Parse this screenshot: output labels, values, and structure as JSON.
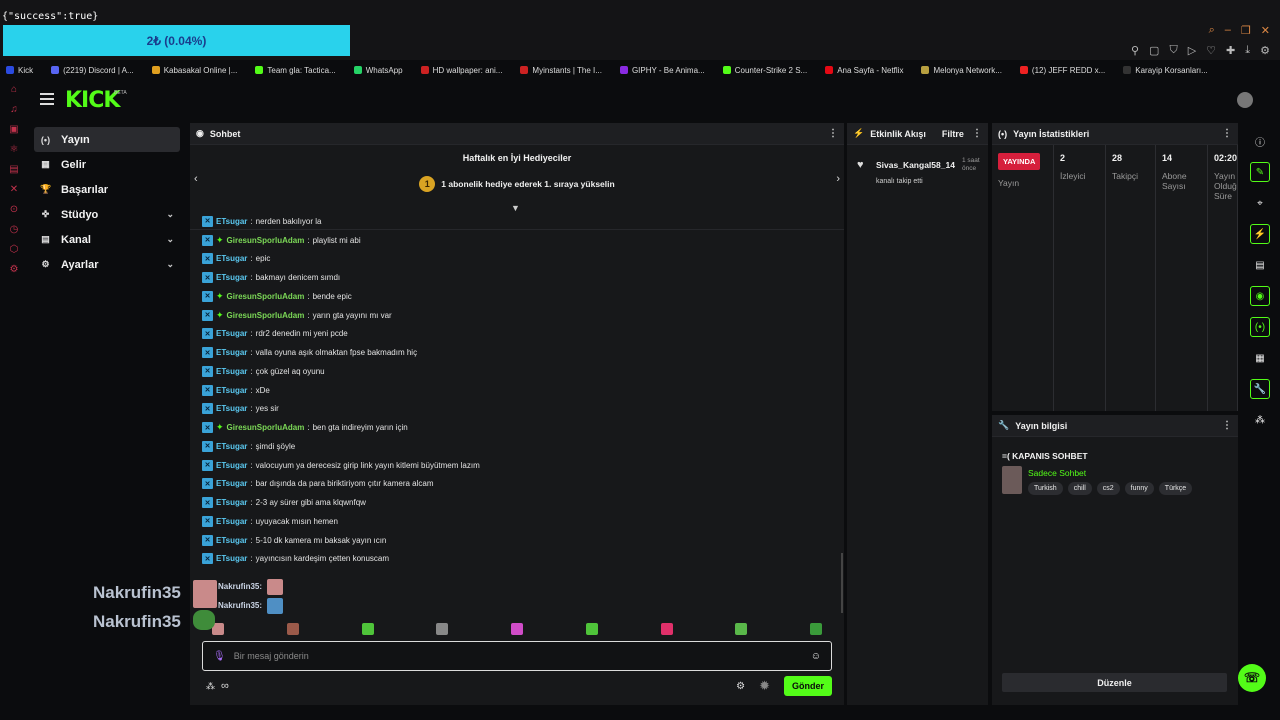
{
  "overlay": {
    "success_text": "{\"success\":true}",
    "donation_bar": "2₺ (0.04%)",
    "nick_primary": "Nakrufin35",
    "nick_secondary": "Nakrufin35"
  },
  "bookmarks": [
    {
      "label": "Kick",
      "color": "#2b4be0"
    },
    {
      "label": "(2219) Discord | A...",
      "color": "#5865f2"
    },
    {
      "label": "Kabasakal Online |...",
      "color": "#e0a020"
    },
    {
      "label": "Team gla: Tactica...",
      "color": "#53fc18"
    },
    {
      "label": "WhatsApp",
      "color": "#25d366"
    },
    {
      "label": "HD wallpaper: ani...",
      "color": "#c22"
    },
    {
      "label": "Myinstants | The I...",
      "color": "#c22"
    },
    {
      "label": "GIPHY - Be Anima...",
      "color": "#8a2be2"
    },
    {
      "label": "Counter-Strike 2 S...",
      "color": "#53fc18"
    },
    {
      "label": "Ana Sayfa - Netflix",
      "color": "#e50914"
    },
    {
      "label": "Melonya Network...",
      "color": "#b8a040"
    },
    {
      "label": "(12) JEFF REDD x...",
      "color": "#e22"
    },
    {
      "label": "Karayip Korsanları...",
      "color": "#333"
    }
  ],
  "nav": {
    "items": [
      {
        "label": "Yayın",
        "icon": "(•)",
        "chev": ""
      },
      {
        "label": "Gelir",
        "icon": "▦",
        "chev": ""
      },
      {
        "label": "Başarılar",
        "icon": "🏆",
        "chev": ""
      },
      {
        "label": "Stüdyo",
        "icon": "✜",
        "chev": "⌄"
      },
      {
        "label": "Kanal",
        "icon": "▤",
        "chev": "⌄"
      },
      {
        "label": "Ayarlar",
        "icon": "⚙",
        "chev": "⌄"
      }
    ]
  },
  "chat": {
    "title": "Sohbet",
    "gifters_title": "Haftalık en İyi Hediyeciler",
    "gifters_rank": "1",
    "gifters_cta": "1 abonelik hediye ederek 1. sıraya yükselin",
    "messages": [
      {
        "user": "ETsugar",
        "text": "nerden bakılıyor la",
        "color": "#5ac8f0",
        "vip": false
      },
      {
        "user": "GiresunSporluAdam",
        "text": "playlist mi abi",
        "color": "#7cd957",
        "vip": true
      },
      {
        "user": "ETsugar",
        "text": "epic",
        "color": "#5ac8f0",
        "vip": false
      },
      {
        "user": "ETsugar",
        "text": "bakmayı denicem sımdı",
        "color": "#5ac8f0",
        "vip": false
      },
      {
        "user": "GiresunSporluAdam",
        "text": "bende epic",
        "color": "#7cd957",
        "vip": true
      },
      {
        "user": "GiresunSporluAdam",
        "text": "yarın gta yayını mı var",
        "color": "#7cd957",
        "vip": true
      },
      {
        "user": "ETsugar",
        "text": "rdr2 denedin mi yeni pcde",
        "color": "#5ac8f0",
        "vip": false
      },
      {
        "user": "ETsugar",
        "text": "valla oyuna aşık olmaktan fpse bakmadım hiç",
        "color": "#5ac8f0",
        "vip": false
      },
      {
        "user": "ETsugar",
        "text": "çok güzel aq oyunu",
        "color": "#5ac8f0",
        "vip": false
      },
      {
        "user": "ETsugar",
        "text": "xDe",
        "color": "#5ac8f0",
        "vip": false
      },
      {
        "user": "ETsugar",
        "text": "yes sir",
        "color": "#5ac8f0",
        "vip": false
      },
      {
        "user": "GiresunSporluAdam",
        "text": "ben gta indireyim yarın için",
        "color": "#7cd957",
        "vip": true
      },
      {
        "user": "ETsugar",
        "text": "şimdi şöyle",
        "color": "#5ac8f0",
        "vip": false
      },
      {
        "user": "ETsugar",
        "text": "valocuyum ya derecesiz girip link yayın kitlemi büyütmem lazım",
        "color": "#5ac8f0",
        "vip": false
      },
      {
        "user": "ETsugar",
        "text": "bar dışında da para biriktiriyom çıtır kamera alcam",
        "color": "#5ac8f0",
        "vip": false
      },
      {
        "user": "ETsugar",
        "text": "2-3 ay sürer gibi ama klqwnfqw",
        "color": "#5ac8f0",
        "vip": false
      },
      {
        "user": "ETsugar",
        "text": "uyuyacak mısın hemen",
        "color": "#5ac8f0",
        "vip": false
      },
      {
        "user": "ETsugar",
        "text": "5-10 dk kamera mı baksak yayın ıcın",
        "color": "#5ac8f0",
        "vip": false
      },
      {
        "user": "ETsugar",
        "text": "yayıncısın kardeşim çetten konuscam",
        "color": "#5ac8f0",
        "vip": false
      }
    ],
    "extra_msgs": [
      {
        "user": "Nakrufin35:"
      },
      {
        "user": "Nakrufin35:"
      }
    ],
    "emote_colors": [
      "#c98a8a",
      "#9b5a4a",
      "#4fc43a",
      "#888",
      "#d04cc8",
      "#4fc43a",
      "#e0306a",
      "#5ab84a",
      "#3a9a3a"
    ],
    "input_placeholder": "Bir mesaj gönderin",
    "infinity": "∞",
    "send_label": "Gönder"
  },
  "activity": {
    "title": "Etkinlik Akışı",
    "filter_label": "Filtre",
    "item": {
      "user": "Sivas_Kangal58_14",
      "time": "1 saat önce",
      "desc": "kanalı takip etti"
    }
  },
  "stats": {
    "title": "Yayın İstatistikleri",
    "live_badge": "YAYINDA",
    "columns": [
      {
        "value": "",
        "label": "Yayın"
      },
      {
        "value": "2",
        "label": "İzleyici"
      },
      {
        "value": "28",
        "label": "Takipçi"
      },
      {
        "value": "14",
        "label": "Abone Sayısı"
      },
      {
        "value": "02:20",
        "label": "Yayın Olduğ Süre"
      }
    ]
  },
  "info": {
    "title": "Yayın bilgisi",
    "stream_title": "=( KAPANIS SOHBET",
    "category": "Sadece Sohbet",
    "tags": [
      "Turkish",
      "chill",
      "cs2",
      "funny",
      "Türkçe"
    ],
    "edit_label": "Düzenle"
  },
  "colors": {
    "accent": "#53fc18",
    "live": "#d61f3c",
    "panel": "#18191b",
    "background": "#0b0c0e",
    "donation": "#29d2ec"
  }
}
